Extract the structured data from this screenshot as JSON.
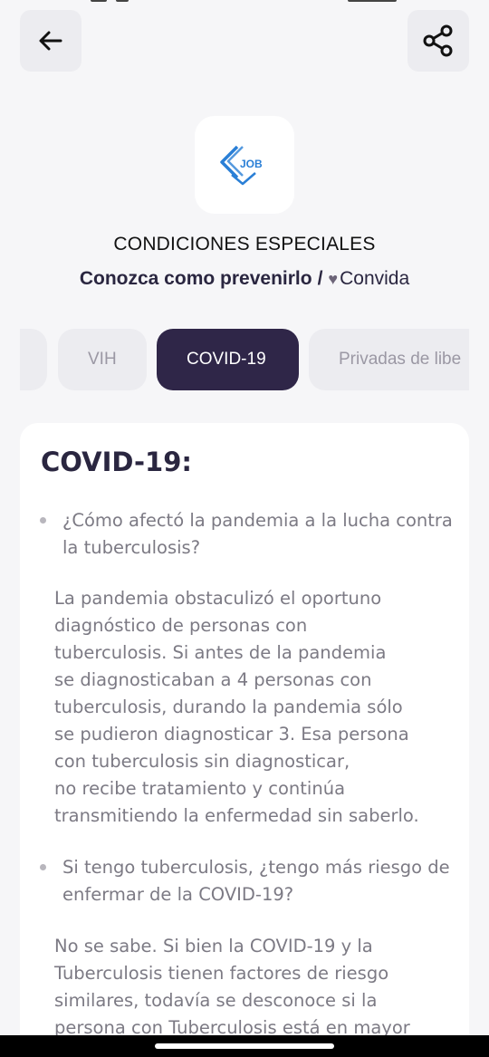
{
  "header": {
    "back_icon": "arrow-left-icon",
    "share_icon": "share-icon",
    "logo_text": "JOB"
  },
  "page": {
    "title": "CONDICIONES ESPECIALES",
    "subtitle_main": "Conozca como prevenirlo",
    "subtitle_separator": "/",
    "subtitle_heart": "♥",
    "subtitle_brand": "Convida"
  },
  "tabs": [
    {
      "label": ""
    },
    {
      "label": "VIH"
    },
    {
      "label": "COVID-19"
    },
    {
      "label": "Privadas de libe"
    }
  ],
  "active_tab": "COVID-19",
  "content": {
    "heading": "COVID-19:",
    "q1": "¿Cómo afectó la pandemia a la lucha contra la tuberculosis?",
    "a1": "La pandemia obstaculizó el oportuno\ndiagnóstico de personas con\ntuberculosis. Si antes de la pandemia\nse diagnosticaban a 4 personas con\ntuberculosis, durando la pandemia sólo\nse pudieron diagnosticar 3. Esa persona\ncon tuberculosis sin diagnosticar,\nno recibe tratamiento y continúa\ntransmitiendo la enfermedad sin saberlo.",
    "q2": "Si tengo tuberculosis, ¿tengo más riesgo de enfermar de la COVID-19?",
    "a2": "No se sabe. Si bien la COVID-19 y la\nTuberculosis tienen factores de riesgo\nsimilares, todavía se desconoce si la\npersona con Tuberculosis está en mayor"
  },
  "colors": {
    "accent": "#2f2648",
    "logo_blue": "#2a7fd6",
    "background": "#f6f6f8"
  }
}
